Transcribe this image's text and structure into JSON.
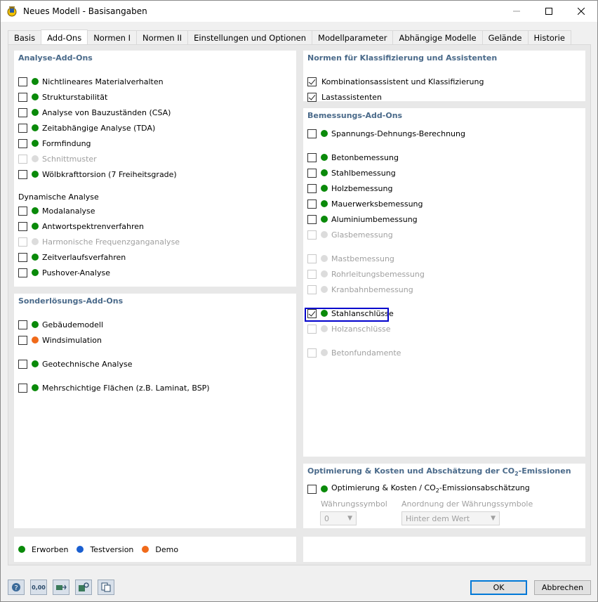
{
  "window": {
    "title": "Neues Modell - Basisangaben",
    "minimize": "—",
    "maximize": "☐",
    "close": "✕"
  },
  "tabs": [
    "Basis",
    "Add-Ons",
    "Normen I",
    "Normen II",
    "Einstellungen und Optionen",
    "Modellparameter",
    "Abhängige Modelle",
    "Gelände",
    "Historie"
  ],
  "active_tab": "Add-Ons",
  "analysis": {
    "title": "Analyse-Add-Ons",
    "items": [
      {
        "label": "Nichtlineares Materialverhalten",
        "status": "green",
        "enabled": true,
        "checked": false
      },
      {
        "label": "Strukturstabilität",
        "status": "green",
        "enabled": true,
        "checked": false
      },
      {
        "label": "Analyse von Bauzuständen (CSA)",
        "status": "green",
        "enabled": true,
        "checked": false
      },
      {
        "label": "Zeitabhängige Analyse (TDA)",
        "status": "green",
        "enabled": true,
        "checked": false
      },
      {
        "label": "Formfindung",
        "status": "green",
        "enabled": true,
        "checked": false
      },
      {
        "label": "Schnittmuster",
        "status": "grey",
        "enabled": false,
        "checked": false
      },
      {
        "label": "Wölbkrafttorsion (7 Freiheitsgrade)",
        "status": "green",
        "enabled": true,
        "checked": false
      }
    ],
    "dynamic_title": "Dynamische Analyse",
    "dynamic_items": [
      {
        "label": "Modalanalyse",
        "status": "green",
        "enabled": true,
        "checked": false
      },
      {
        "label": "Antwortspektrenverfahren",
        "status": "green",
        "enabled": true,
        "checked": false
      },
      {
        "label": "Harmonische Frequenzganganalyse",
        "status": "grey",
        "enabled": false,
        "checked": false
      },
      {
        "label": "Zeitverlaufsverfahren",
        "status": "green",
        "enabled": true,
        "checked": false
      },
      {
        "label": "Pushover-Analyse",
        "status": "green",
        "enabled": true,
        "checked": false
      }
    ]
  },
  "special": {
    "title": "Sonderlösungs-Add-Ons",
    "items": [
      {
        "label": "Gebäudemodell",
        "status": "green",
        "enabled": true,
        "checked": false
      },
      {
        "label": "Windsimulation",
        "status": "orange",
        "enabled": true,
        "checked": false
      },
      {
        "label": "Geotechnische Analyse",
        "status": "green",
        "enabled": true,
        "checked": false
      },
      {
        "label": "Mehrschichtige Flächen (z.B. Laminat, BSP)",
        "status": "green",
        "enabled": true,
        "checked": false
      }
    ]
  },
  "norms": {
    "title": "Normen für Klassifizierung und Assistenten",
    "items": [
      {
        "label": "Kombinationsassistent und Klassifizierung",
        "checked": true
      },
      {
        "label": "Lastassistenten",
        "checked": true
      }
    ]
  },
  "design": {
    "title": "Bemessungs-Add-Ons",
    "items": [
      {
        "label": "Spannungs-Dehnungs-Berechnung",
        "status": "green",
        "enabled": true,
        "checked": false
      },
      {
        "label": "Betonbemessung",
        "status": "green",
        "enabled": true,
        "checked": false
      },
      {
        "label": "Stahlbemessung",
        "status": "green",
        "enabled": true,
        "checked": false
      },
      {
        "label": "Holzbemessung",
        "status": "green",
        "enabled": true,
        "checked": false
      },
      {
        "label": "Mauerwerksbemessung",
        "status": "green",
        "enabled": true,
        "checked": false
      },
      {
        "label": "Aluminiumbemessung",
        "status": "green",
        "enabled": true,
        "checked": false
      },
      {
        "label": "Glasbemessung",
        "status": "grey",
        "enabled": false,
        "checked": false
      },
      {
        "label": "Mastbemessung",
        "status": "grey",
        "enabled": false,
        "checked": false
      },
      {
        "label": "Rohrleitungsbemessung",
        "status": "grey",
        "enabled": false,
        "checked": false
      },
      {
        "label": "Kranbahnbemessung",
        "status": "grey",
        "enabled": false,
        "checked": false
      },
      {
        "label": "Stahlanschlüsse",
        "status": "green",
        "enabled": true,
        "checked": true
      },
      {
        "label": "Holzanschlüsse",
        "status": "grey",
        "enabled": false,
        "checked": false
      },
      {
        "label": "Betonfundamente",
        "status": "grey",
        "enabled": false,
        "checked": false
      }
    ]
  },
  "optim": {
    "title_prefix": "Optimierung & Kosten und Abschätzung der CO",
    "title_sub": "2",
    "title_suffix": "-Emissionen",
    "item_prefix": "Optimierung & Kosten / CO",
    "item_sub": "2",
    "item_suffix": "-Emissionsabschätzung",
    "currency_label": "Währungssymbol",
    "currency_value": "0",
    "arrangement_label": "Anordnung der Währungssymbole",
    "arrangement_value": "Hinter dem Wert"
  },
  "legend": [
    {
      "label": "Erworben",
      "color": "green"
    },
    {
      "label": "Testversion",
      "color": "blue"
    },
    {
      "label": "Demo",
      "color": "orange"
    }
  ],
  "bottom_icons": [
    "help-icon",
    "units-icon",
    "model-export-icon",
    "model-settings-icon",
    "copy-icon"
  ],
  "units_icon_text": "0,00",
  "buttons": {
    "ok": "OK",
    "cancel": "Abbrechen"
  },
  "colors": {
    "green": "#0a8a0a",
    "blue": "#1a5fd0",
    "orange": "#f06a1a",
    "grey": "#dcdcdc",
    "focus": "#0000cc",
    "section_title": "#4a6a8a"
  }
}
